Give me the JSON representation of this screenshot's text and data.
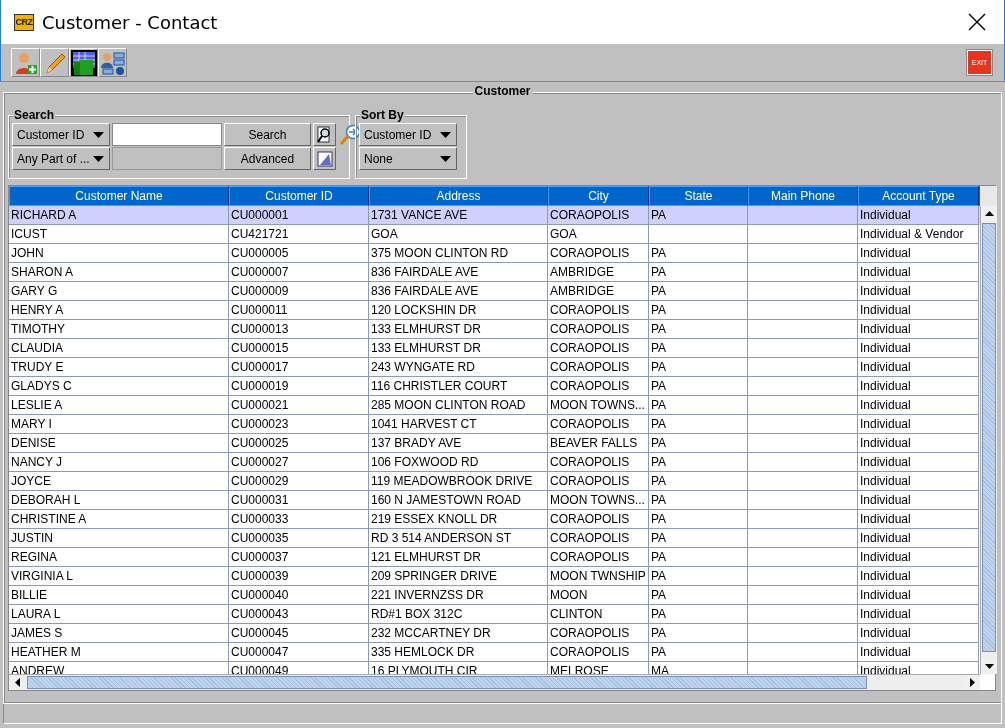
{
  "window": {
    "logo": "CRZ",
    "title": "Customer - Contact"
  },
  "toolbar": {
    "exit_label": "EXIT"
  },
  "panel": {
    "title": "Customer"
  },
  "search": {
    "title": "Search",
    "field_combo": "Customer ID",
    "match_combo": "Any Part of ...",
    "search_button": "Search",
    "advanced_button": "Advanced"
  },
  "sort": {
    "title": "Sort By",
    "combos": [
      "Customer ID",
      "None"
    ]
  },
  "table": {
    "columns": [
      "Customer Name",
      "Customer ID",
      "Address",
      "City",
      "State",
      "Main Phone",
      "Account Type"
    ],
    "rows": [
      {
        "selected": true,
        "cells": [
          "RICHARD A",
          "CU000001",
          "1731 VANCE AVE",
          "CORAOPOLIS",
          "PA",
          "",
          "Individual"
        ]
      },
      {
        "selected": false,
        "cells": [
          "ICUST",
          "CU421721",
          "GOA",
          "GOA",
          "",
          "",
          "Individual & Vendor"
        ]
      },
      {
        "selected": false,
        "cells": [
          "JOHN",
          "CU000005",
          "375 MOON CLINTON RD",
          "CORAOPOLIS",
          "PA",
          "",
          "Individual"
        ]
      },
      {
        "selected": false,
        "cells": [
          "SHARON A",
          "CU000007",
          "836 FAIRDALE AVE",
          "AMBRIDGE",
          "PA",
          "",
          "Individual"
        ]
      },
      {
        "selected": false,
        "cells": [
          "GARY G",
          "CU000009",
          "836 FAIRDALE AVE",
          "AMBRIDGE",
          "PA",
          "",
          "Individual"
        ]
      },
      {
        "selected": false,
        "cells": [
          "HENRY A",
          "CU000011",
          "120 LOCKSHIN DR",
          "CORAOPOLIS",
          "PA",
          "",
          "Individual"
        ]
      },
      {
        "selected": false,
        "cells": [
          "TIMOTHY",
          "CU000013",
          "133 ELMHURST DR",
          "CORAOPOLIS",
          "PA",
          "",
          "Individual"
        ]
      },
      {
        "selected": false,
        "cells": [
          "CLAUDIA",
          "CU000015",
          "133 ELMHURST DR",
          "CORAOPOLIS",
          "PA",
          "",
          "Individual"
        ]
      },
      {
        "selected": false,
        "cells": [
          "TRUDY E",
          "CU000017",
          "243 WYNGATE RD",
          "CORAOPOLIS",
          "PA",
          "",
          "Individual"
        ]
      },
      {
        "selected": false,
        "cells": [
          "GLADYS C",
          "CU000019",
          "116 CHRISTLER COURT",
          "CORAOPOLIS",
          "PA",
          "",
          "Individual"
        ]
      },
      {
        "selected": false,
        "cells": [
          "LESLIE A",
          "CU000021",
          "285 MOON CLINTON ROAD",
          "MOON TOWNS...",
          "PA",
          "",
          "Individual"
        ]
      },
      {
        "selected": false,
        "cells": [
          "MARY I",
          "CU000023",
          "1041 HARVEST CT",
          "CORAOPOLIS",
          "PA",
          "",
          "Individual"
        ]
      },
      {
        "selected": false,
        "cells": [
          "DENISE",
          "CU000025",
          "137 BRADY AVE",
          "BEAVER FALLS",
          "PA",
          "",
          "Individual"
        ]
      },
      {
        "selected": false,
        "cells": [
          "NANCY J",
          "CU000027",
          "106 FOXWOOD RD",
          "CORAOPOLIS",
          "PA",
          "",
          "Individual"
        ]
      },
      {
        "selected": false,
        "cells": [
          "JOYCE",
          "CU000029",
          "119 MEADOWBROOK DRIVE",
          "CORAOPOLIS",
          "PA",
          "",
          "Individual"
        ]
      },
      {
        "selected": false,
        "cells": [
          "DEBORAH L",
          "CU000031",
          "160 N JAMESTOWN ROAD",
          "MOON TOWNS...",
          "PA",
          "",
          "Individual"
        ]
      },
      {
        "selected": false,
        "cells": [
          "CHRISTINE A",
          "CU000033",
          "219 ESSEX KNOLL DR",
          "CORAOPOLIS",
          "PA",
          "",
          "Individual"
        ]
      },
      {
        "selected": false,
        "cells": [
          "JUSTIN",
          "CU000035",
          "RD 3 514 ANDERSON ST",
          "CORAOPOLIS",
          "PA",
          "",
          "Individual"
        ]
      },
      {
        "selected": false,
        "cells": [
          "REGINA",
          "CU000037",
          "121 ELMHURST DR",
          "CORAOPOLIS",
          "PA",
          "",
          "Individual"
        ]
      },
      {
        "selected": false,
        "cells": [
          "VIRGINIA L",
          "CU000039",
          "209 SPRINGER DRIVE",
          "MOON TWNSHIP",
          "PA",
          "",
          "Individual"
        ]
      },
      {
        "selected": false,
        "cells": [
          "BILLIE",
          "CU000040",
          "221 INVERNZSS DR",
          "MOON",
          "PA",
          "",
          "Individual"
        ]
      },
      {
        "selected": false,
        "cells": [
          "LAURA L",
          "CU000043",
          "RD#1 BOX 312C",
          "CLINTON",
          "PA",
          "",
          "Individual"
        ]
      },
      {
        "selected": false,
        "cells": [
          "JAMES S",
          "CU000045",
          "232 MCCARTNEY DR",
          "CORAOPOLIS",
          "PA",
          "",
          "Individual"
        ]
      },
      {
        "selected": false,
        "cells": [
          "HEATHER M",
          "CU000047",
          "335 HEMLOCK DR",
          "CORAOPOLIS",
          "PA",
          "",
          "Individual"
        ]
      },
      {
        "selected": false,
        "cells": [
          "ANDREW",
          "CU000049",
          "16 PLYMOUTH CIR",
          "MELROSE",
          "MA",
          "",
          "Individual"
        ]
      }
    ]
  }
}
